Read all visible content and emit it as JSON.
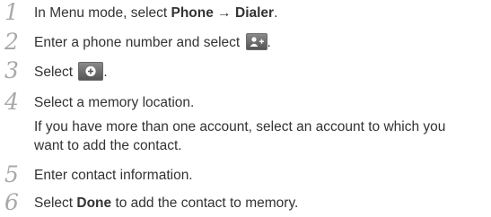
{
  "steps": [
    {
      "number": "1",
      "prefix": "In Menu mode, select ",
      "bold1": "Phone",
      "arrow": " → ",
      "bold2": "Dialer",
      "suffix": "."
    },
    {
      "number": "2",
      "text": "Enter a phone number and select ",
      "suffix": ".",
      "icon": "add-contact-icon"
    },
    {
      "number": "3",
      "text": "Select ",
      "suffix": ".",
      "icon": "plus-circle-icon"
    },
    {
      "number": "4",
      "text": "Select a memory location.",
      "note_line1": "If you have more than one account, select an account to which you",
      "note_line2": "want to add the contact."
    },
    {
      "number": "5",
      "text": "Enter contact information."
    },
    {
      "number": "6",
      "prefix": "Select ",
      "bold": "Done",
      "suffix": " to add the contact to memory."
    }
  ]
}
